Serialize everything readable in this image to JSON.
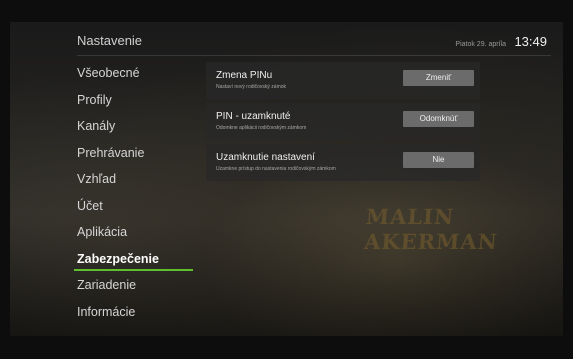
{
  "header": {
    "title": "Nastavenie",
    "date": "Piatok 29. apríla",
    "time": "13:49"
  },
  "menu": {
    "items": [
      {
        "label": "Všeobecné"
      },
      {
        "label": "Profily"
      },
      {
        "label": "Kanály"
      },
      {
        "label": "Prehrávanie"
      },
      {
        "label": "Vzhľad"
      },
      {
        "label": "Účet"
      },
      {
        "label": "Aplikácia"
      },
      {
        "label": "Zabezpečenie"
      },
      {
        "label": "Zariadenie"
      },
      {
        "label": "Informácie"
      }
    ],
    "active_index": 7
  },
  "settings": [
    {
      "title": "Zmena PINu",
      "subtitle": "Nastaví nový rodičovský zámok",
      "button": "Zmeniť"
    },
    {
      "title": "PIN - uzamknuté",
      "subtitle": "Odomkne aplikácii rodičovským zámkom",
      "button": "Odomknúť"
    },
    {
      "title": "Uzamknutie nastavení",
      "subtitle": "Uzamkne prístup do nastavenia rodičovským zámkom",
      "button": "Nie"
    }
  ],
  "background": {
    "caption": "MALIN AKERMAN"
  },
  "colors": {
    "accent": "#5fbf2f",
    "button": "#6b6b6b"
  }
}
